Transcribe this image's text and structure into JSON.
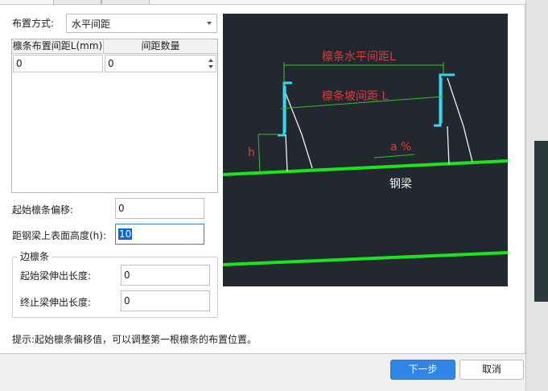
{
  "layout_label": "布置方式:",
  "layout_select": "水平间距",
  "grid": {
    "headers": [
      "檩条布置间距L(mm)",
      "间距数量"
    ],
    "row": [
      "0",
      "0"
    ]
  },
  "offset": {
    "label": "起始檩条偏移:",
    "value": "0"
  },
  "height": {
    "label": "距钢梁上表面高度(h):",
    "value": "10"
  },
  "edge_group": {
    "title": "边檩条",
    "start_label": "起始梁伸出长度:",
    "start_value": "0",
    "end_label": "终止梁伸出长度:",
    "end_value": "0"
  },
  "diagram": {
    "horizontal_label": "檩条水平间距L",
    "slope_label": "檩条坡间距 L",
    "angle_label": "a %",
    "h_label": "h",
    "beam_label": "钢梁",
    "colors": {
      "background": "#222730",
      "beam": "#19e619",
      "purlin": "#34d8f0",
      "dimension": "#2ec42e",
      "red_text": "#e03a3a",
      "white": "#f2f2f2"
    }
  },
  "hint": "提示:起始檩条偏移值，可以调整第一根檩条的布置位置。",
  "buttons": {
    "next": "下一步",
    "cancel": "取消"
  },
  "icons": [
    "dropdown-arrow-icon",
    "spin-up-icon",
    "spin-down-icon"
  ]
}
